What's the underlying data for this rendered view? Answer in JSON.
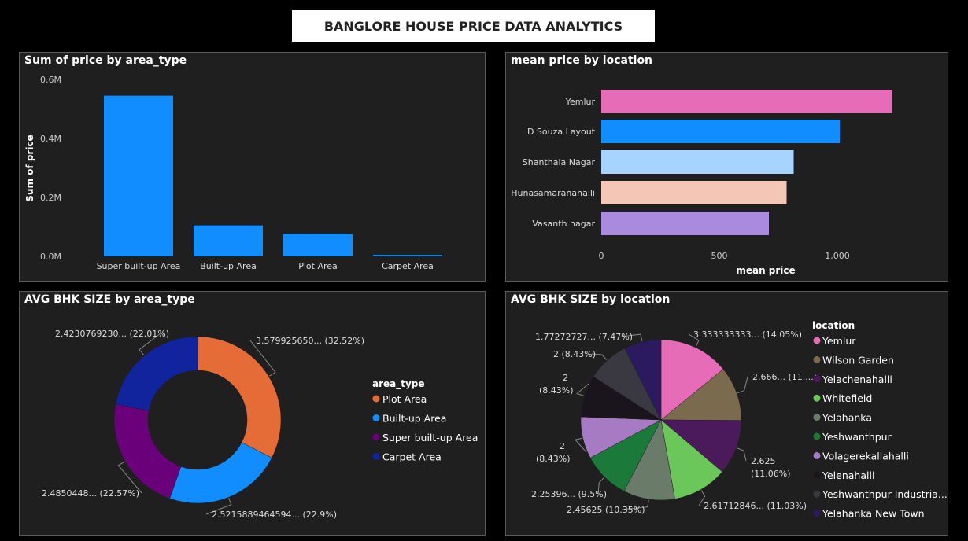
{
  "dashboard_title": "BANGLORE HOUSE PRICE DATA ANALYTICS",
  "charts": {
    "c1": {
      "title": "Sum of price by area_type",
      "ylabel": "Sum of price",
      "yticks": [
        "0.0M",
        "0.2M",
        "0.4M",
        "0.6M"
      ]
    },
    "c2": {
      "title": "mean price by location",
      "xlabel": "mean price",
      "xticks": [
        "0",
        "500",
        "1,000"
      ]
    },
    "c3": {
      "title": "AVG BHK SIZE by area_type",
      "legend_title": "area_type"
    },
    "c4": {
      "title": "AVG BHK SIZE by location",
      "legend_title": "location"
    }
  },
  "chart_data": [
    {
      "type": "bar",
      "title": "Sum of price by area_type",
      "xlabel": "",
      "ylabel": "Sum of price",
      "categories": [
        "Super built-up Area",
        "Built-up Area",
        "Plot Area",
        "Carpet Area"
      ],
      "values": [
        545000,
        105000,
        77000,
        5000
      ],
      "ylim": [
        0,
        600000
      ],
      "color": "#118DFF",
      "grid": false
    },
    {
      "type": "bar",
      "orientation": "horizontal",
      "title": "mean price by location",
      "xlabel": "mean price",
      "ylabel": "",
      "categories": [
        "Yemlur",
        "D Souza Layout",
        "Shanthala Nagar",
        "Hunasamaranahalli",
        "Vasanth nagar"
      ],
      "values": [
        1232,
        1010,
        815,
        785,
        710
      ],
      "xlim": [
        0,
        1300
      ],
      "colors": [
        "#E66CB7",
        "#118DFF",
        "#A7D3FF",
        "#F4C6B5",
        "#A98ADF"
      ],
      "grid": false
    },
    {
      "type": "pie",
      "style": "donut",
      "title": "AVG BHK SIZE by area_type",
      "legend_title": "area_type",
      "legend_position": "right",
      "slices": [
        {
          "name": "Plot  Area",
          "value": 3.57992565,
          "percent": 32.52,
          "color": "#E66C37",
          "label": "3.579925650... (32.52%)"
        },
        {
          "name": "Built-up  Area",
          "value": 2.5215889464594,
          "percent": 22.9,
          "color": "#118DFF",
          "label": "2.5215889464594... (22.9%)"
        },
        {
          "name": "Super built-up  Area",
          "value": 2.4850448,
          "percent": 22.57,
          "color": "#6B007B",
          "label": "2.4850448... (22.57%)"
        },
        {
          "name": "Carpet  Area",
          "value": 2.423076923,
          "percent": 22.01,
          "color": "#12239E",
          "label": "2.4230769230... (22.01%)"
        }
      ]
    },
    {
      "type": "pie",
      "title": "AVG BHK SIZE by location",
      "legend_title": "location",
      "legend_position": "right",
      "slices": [
        {
          "name": "Yemlur",
          "value": 3.333333333,
          "percent": 14.05,
          "color": "#E66CB7",
          "label": "3.333333333... (14.05%)"
        },
        {
          "name": "Wilson Garden",
          "value": 2.666,
          "percent": 11.0,
          "color": "#7A6B4E",
          "label": "2.666... (11....)"
        },
        {
          "name": "Yelachenahalli",
          "value": 2.625,
          "percent": 11.06,
          "color": "#4B1A5A",
          "label": "2.625 (11.06%)"
        },
        {
          "name": "Whitefield",
          "value": 2.61712846,
          "percent": 11.03,
          "color": "#6BC75A",
          "label": "2.61712846... (11.03%)"
        },
        {
          "name": "Yelahanka",
          "value": 2.45625,
          "percent": 10.35,
          "color": "#6B7B6A",
          "label": "2.45625 (10.35%)"
        },
        {
          "name": "Yeshwanthpur",
          "value": 2.25396,
          "percent": 9.5,
          "color": "#1B7A3A",
          "label": "2.25396... (9.5%)"
        },
        {
          "name": "Volagerekallahalli",
          "value": 2,
          "percent": 8.43,
          "color": "#A77BC4",
          "label": "2 (8.43%)"
        },
        {
          "name": "Yelenahalli",
          "value": 2,
          "percent": 8.43,
          "color": "#1A141C",
          "label": "2 (8.43%)"
        },
        {
          "name": "Yeshwanthpur Industria...",
          "value": 2,
          "percent": 8.43,
          "color": "#3A3840",
          "label": "2 (8.43%)"
        },
        {
          "name": "Yelahanka New Town",
          "value": 1.77272727,
          "percent": 7.47,
          "color": "#2B1A5E",
          "label": "1.77272727... (7.47%)"
        }
      ]
    }
  ]
}
